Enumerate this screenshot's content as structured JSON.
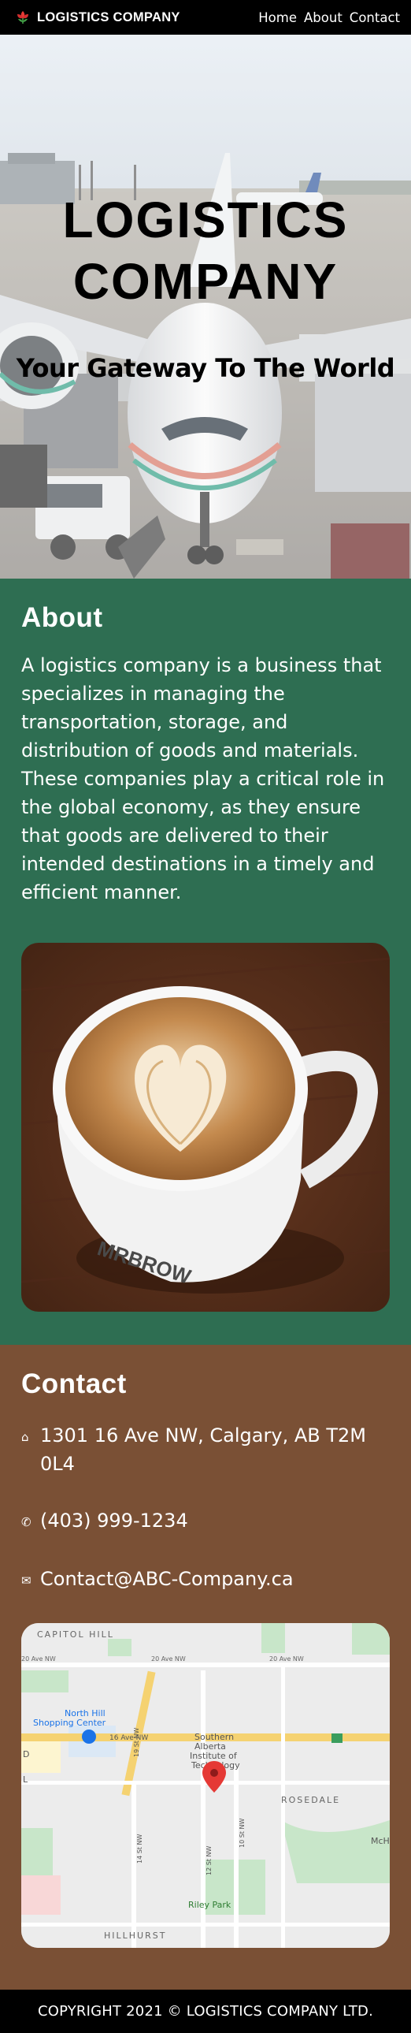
{
  "navbar": {
    "brand": "LOGISTICS COMPANY",
    "logo_icon": "red-flower-icon",
    "links": [
      "Home",
      "About",
      "Contact"
    ]
  },
  "hero": {
    "title_line1": "LOGISTICS",
    "title_line2": "COMPANY",
    "subtitle": "Your Gateway To The World",
    "image_icon": "airplane-at-airport-photo"
  },
  "about": {
    "title": "About",
    "text": "A logistics company is a business that specializes in managing the transportation, storage, and distribution of goods and materials. These companies play a critical role in the global economy, as they ensure that goods are delivered to their intended destinations in a timely and efficient manner.",
    "image_icon": "latte-art-coffee-cup-photo",
    "cup_text": "MRBROW"
  },
  "contact": {
    "title": "Contact",
    "address": "1301 16 Ave NW, Calgary, AB T2M 0L4",
    "phone": "(403) 999-1234",
    "email": "Contact@ABC-Company.ca",
    "address_icon": "home-icon",
    "phone_icon": "phone-icon",
    "email_icon": "mail-icon"
  },
  "map": {
    "labels": {
      "capitol_hill": "CAPITOL HILL",
      "ave_20_left": "20 Ave NW",
      "ave_20_mid": "20 Ave NW",
      "ave_20_right": "20 Ave NW",
      "north_hill": "North Hill",
      "shopping_center": "Shopping Center",
      "ave_16": "16 Ave NW",
      "st_19": "19 St NW",
      "sait_1": "Southern",
      "sait_2": "Alberta",
      "sait_3": "Institute of",
      "sait_4": "Technology",
      "rosedale": "ROSEDALE",
      "st_10": "10 St NW",
      "st_14": "14 St NW",
      "st_12": "12 St NW",
      "riley_park": "Riley Park",
      "hillhurst": "HILLHURST",
      "mch": "McH",
      "d": "D",
      "l": "L"
    },
    "pin_color": "#e53935"
  },
  "footer": {
    "copyright": "COPYRIGHT 2021 © LOGISTICS COMPANY LTD."
  },
  "colors": {
    "about_bg": "#2e6e52",
    "contact_bg": "#7a5035",
    "nav_bg": "#000000"
  }
}
